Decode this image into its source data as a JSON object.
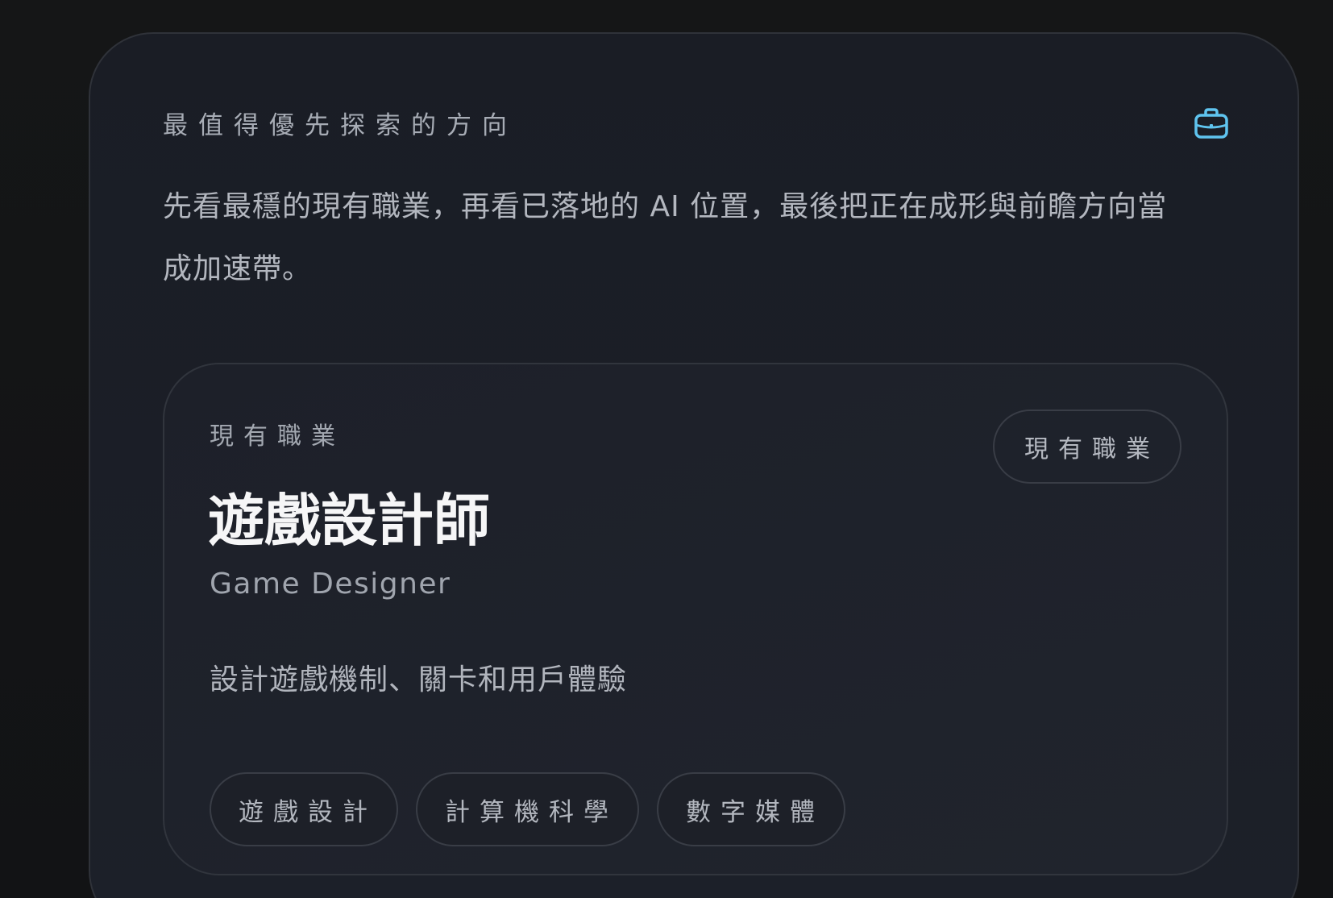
{
  "panel": {
    "eyebrow": "最值得優先探索的方向",
    "icon": "briefcase-icon",
    "lead": "先看最穩的現有職業，再看已落地的 AI 位置，最後把正在成形與前瞻方向當成加速帶。"
  },
  "card": {
    "eyebrow": "現有職業",
    "badge": "現有職業",
    "title": "遊戲設計師",
    "subtitle": "Game Designer",
    "description": "設計遊戲機制、關卡和用戶體驗",
    "tags": [
      "遊戲設計",
      "計算機科學",
      "數字媒體"
    ]
  },
  "colors": {
    "accent": "#5fc4ef",
    "background": "#131416",
    "panel": "#1b1e26"
  }
}
